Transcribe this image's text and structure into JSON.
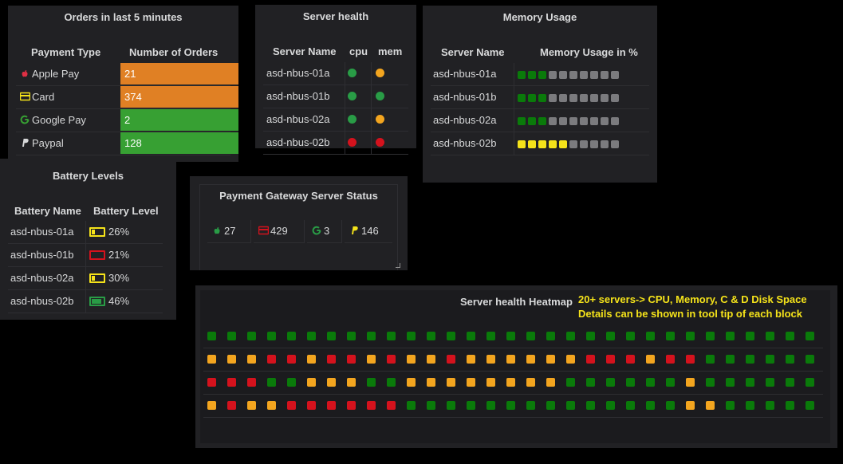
{
  "colors": {
    "green": "#299c46",
    "orange": "#e08024",
    "red": "#d4121d",
    "yellow": "#f5e31a",
    "amber": "#f3a51f",
    "dkgreen": "#0a7a0a",
    "gray": "#7b7b7e"
  },
  "orders": {
    "title": "Orders in last 5 minutes",
    "col_type": "Payment Type",
    "col_count": "Number of Orders",
    "rows": [
      {
        "icon": "apple-icon",
        "label": "Apple Pay",
        "value": "21",
        "color": "#e08024",
        "icon_color": "#e02f44"
      },
      {
        "icon": "card-icon",
        "label": "Card",
        "value": "374",
        "color": "#e08024",
        "icon_color": "#f5e31a"
      },
      {
        "icon": "google-icon",
        "label": "Google Pay",
        "value": "2",
        "color": "#37a033",
        "icon_color": "#37a033"
      },
      {
        "icon": "paypal-icon",
        "label": "Paypal",
        "value": "128",
        "color": "#37a033",
        "icon_color": "#d8d9da"
      }
    ]
  },
  "server_health": {
    "title": "Server health",
    "col_name": "Server Name",
    "col_cpu": "cpu",
    "col_mem": "mem",
    "rows": [
      {
        "name": "asd-nbus-01a",
        "cpu": "green",
        "mem": "amber"
      },
      {
        "name": "asd-nbus-01b",
        "cpu": "green",
        "mem": "green"
      },
      {
        "name": "asd-nbus-02a",
        "cpu": "green",
        "mem": "amber"
      },
      {
        "name": "asd-nbus-02b",
        "cpu": "red",
        "mem": "red"
      }
    ]
  },
  "memory": {
    "title": "Memory Usage",
    "col_name": "Server Name",
    "col_usage": "Memory Usage in %",
    "rows": [
      {
        "name": "asd-nbus-01a",
        "filled": 3,
        "color": "green"
      },
      {
        "name": "asd-nbus-01b",
        "filled": 3,
        "color": "green"
      },
      {
        "name": "asd-nbus-02a",
        "filled": 3,
        "color": "green"
      },
      {
        "name": "asd-nbus-02b",
        "filled": 5,
        "color": "yellow"
      }
    ],
    "total_blocks": 10
  },
  "battery": {
    "title": "Battery Levels",
    "col_name": "Battery Name",
    "col_level": "Battery Level",
    "rows": [
      {
        "name": "asd-nbus-01a",
        "level": "26%",
        "fraction": 0.26,
        "color": "#f5e31a"
      },
      {
        "name": "asd-nbus-01b",
        "level": "21%",
        "fraction": 0.0,
        "color": "#d4121d"
      },
      {
        "name": "asd-nbus-02a",
        "level": "30%",
        "fraction": 0.3,
        "color": "#f5e31a"
      },
      {
        "name": "asd-nbus-02b",
        "level": "46%",
        "fraction": 0.85,
        "color": "#299c46"
      }
    ]
  },
  "gateway": {
    "title": "Payment Gateway Server Status",
    "items": [
      {
        "icon": "apple-icon",
        "value": "27",
        "color": "#299c46"
      },
      {
        "icon": "card-icon",
        "value": "429",
        "color": "#d4121d"
      },
      {
        "icon": "google-icon",
        "value": "3",
        "color": "#299c46"
      },
      {
        "icon": "paypal-icon",
        "value": "146",
        "color": "#f5e31a"
      }
    ]
  },
  "heatmap": {
    "title": "Server health Heatmap",
    "note_line1": "20+ servers-> CPU, Memory, C & D Disk Space",
    "note_line2": "Details can be shown in tool tip of each block",
    "rows": [
      "GGGGGGGGGGGGGGGGGGGGGGGGGGGGGGG",
      "AAARRARRARAARAAAAAARRRARRGG",
      "RRRGGAAAGGAAAAAAAAGGGGGGAGGGGG",
      "ARAARRRRRRGGGGGGGGGGGGGGAAGGGG"
    ],
    "cols": 31
  }
}
